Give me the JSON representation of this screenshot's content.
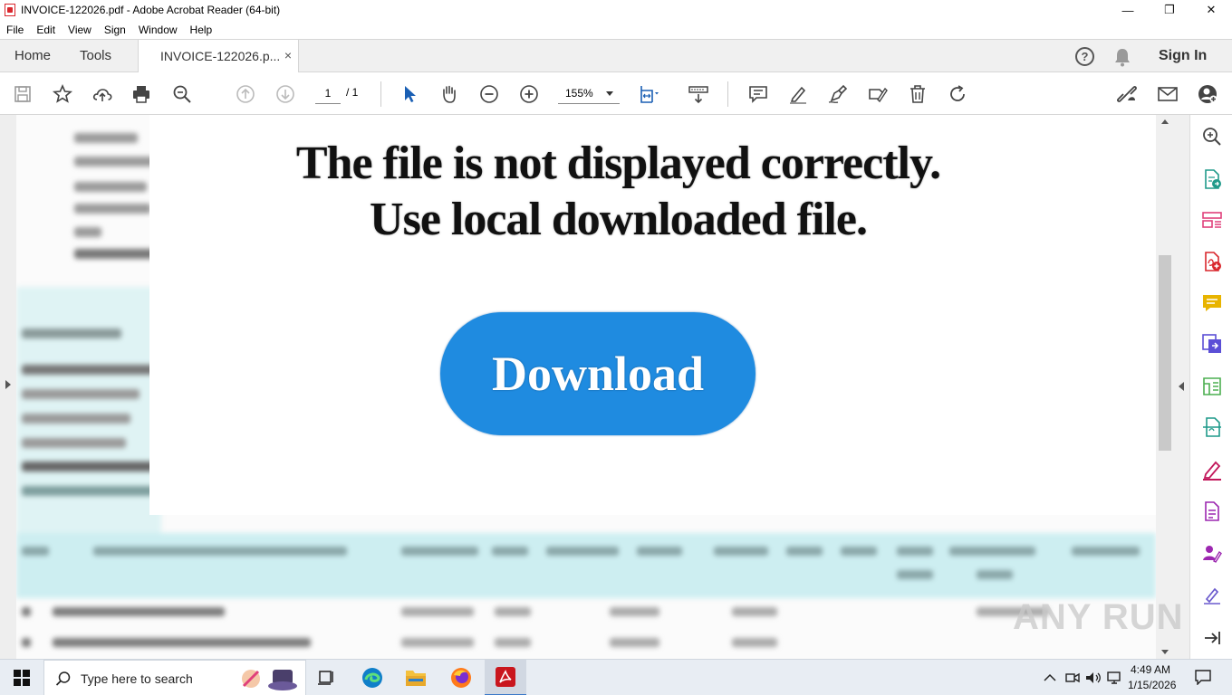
{
  "window": {
    "title": "INVOICE-122026.pdf - Adobe Acrobat Reader (64-bit)",
    "controls": {
      "minimize": "—",
      "maximize": "❐",
      "close": "✕"
    }
  },
  "menu": [
    "File",
    "Edit",
    "View",
    "Sign",
    "Window",
    "Help"
  ],
  "tabs": {
    "home": "Home",
    "tools": "Tools",
    "document": "INVOICE-122026.p...",
    "document_close": "×",
    "sign_in": "Sign In",
    "help_icon": "?"
  },
  "toolbar": {
    "page_current": "1",
    "page_total": "/ 1",
    "zoom": "155%"
  },
  "document": {
    "message_line1": "The file is not displayed correctly.",
    "message_line2": "Use local downloaded file.",
    "download_label": "Download",
    "accent_color": "#1f8be0"
  },
  "watermark": "ANY RUN",
  "taskbar": {
    "search_placeholder": "Type here to search",
    "time": "4:49 AM",
    "date": "1/15/2026"
  }
}
